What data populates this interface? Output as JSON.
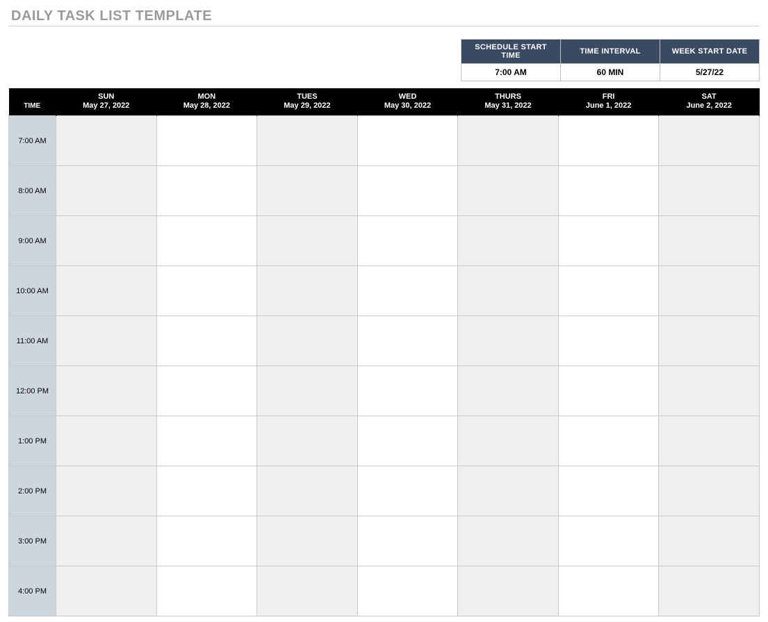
{
  "title": "DAILY TASK LIST TEMPLATE",
  "config": {
    "headers": {
      "start_time": "SCHEDULE START TIME",
      "interval": "TIME INTERVAL",
      "week_start": "WEEK START DATE"
    },
    "values": {
      "start_time": "7:00 AM",
      "interval": "60 MIN",
      "week_start": "5/27/22"
    }
  },
  "schedule": {
    "time_header": "TIME",
    "days": [
      {
        "name": "SUN",
        "date": "May 27, 2022"
      },
      {
        "name": "MON",
        "date": "May 28, 2022"
      },
      {
        "name": "TUES",
        "date": "May 29, 2022"
      },
      {
        "name": "WED",
        "date": "May 30, 2022"
      },
      {
        "name": "THURS",
        "date": "May 31, 2022"
      },
      {
        "name": "FRI",
        "date": "June 1, 2022"
      },
      {
        "name": "SAT",
        "date": "June 2, 2022"
      }
    ],
    "times": [
      "7:00 AM",
      "8:00 AM",
      "9:00 AM",
      "10:00 AM",
      "11:00 AM",
      "12:00 PM",
      "1:00 PM",
      "2:00 PM",
      "3:00 PM",
      "4:00 PM"
    ]
  }
}
